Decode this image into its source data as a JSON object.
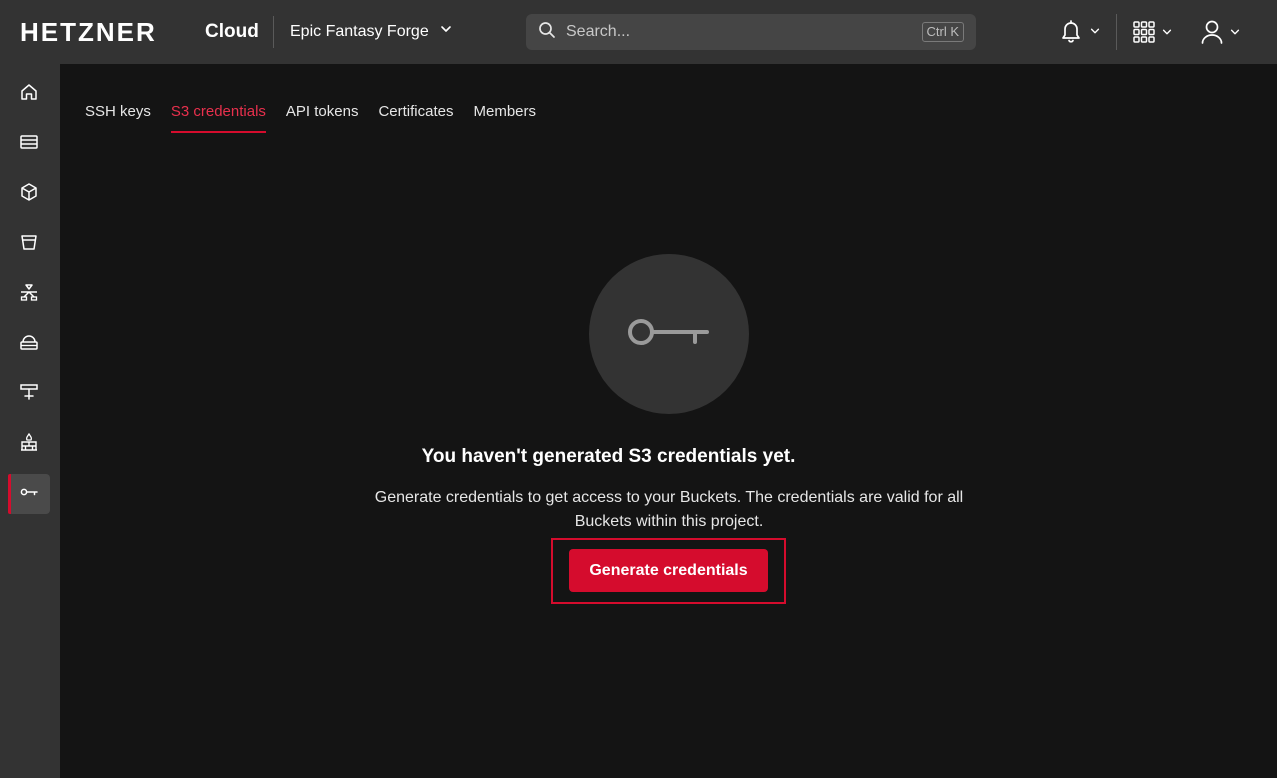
{
  "header": {
    "logo_text": "HETZNER",
    "logo_sub": "Cloud",
    "project_name": "Epic Fantasy Forge",
    "search_placeholder": "Search...",
    "search_shortcut": "Ctrl K"
  },
  "sidebar": {
    "items": [
      {
        "name": "home",
        "icon": "home-icon"
      },
      {
        "name": "servers",
        "icon": "server-icon"
      },
      {
        "name": "volumes",
        "icon": "cube-icon"
      },
      {
        "name": "object-storage",
        "icon": "bucket-icon"
      },
      {
        "name": "load-balancers",
        "icon": "load-balancer-icon"
      },
      {
        "name": "networks",
        "icon": "network-icon"
      },
      {
        "name": "floating-ips",
        "icon": "ip-icon"
      },
      {
        "name": "firewalls",
        "icon": "firewall-icon"
      },
      {
        "name": "security",
        "icon": "key-icon",
        "active": true
      }
    ]
  },
  "tabs": [
    {
      "label": "SSH keys",
      "active": false
    },
    {
      "label": "S3 credentials",
      "active": true
    },
    {
      "label": "API tokens",
      "active": false
    },
    {
      "label": "Certificates",
      "active": false
    },
    {
      "label": "Members",
      "active": false
    }
  ],
  "empty_state": {
    "icon": "key-icon",
    "title": "You haven't generated S3 credentials yet.",
    "description": "Generate credentials to get access to your Buckets. The credentials are valid for all Buckets within this project.",
    "button_label": "Generate credentials"
  },
  "colors": {
    "accent": "#d50c2d",
    "topbar": "#333333",
    "background": "#141414"
  }
}
